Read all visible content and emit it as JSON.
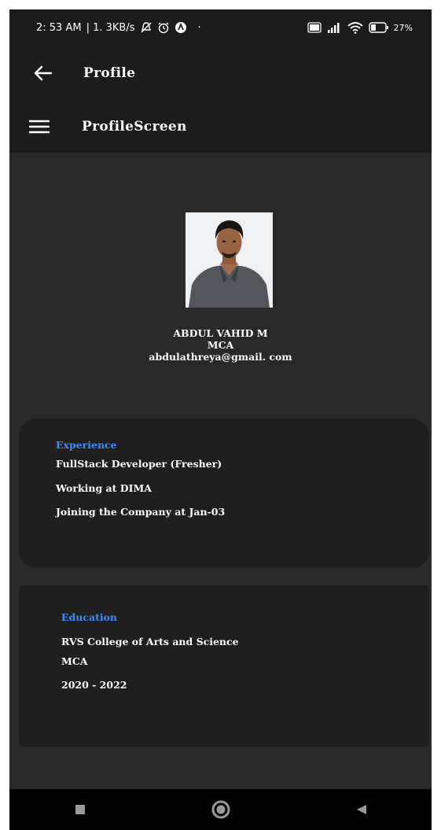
{
  "status_bar": {
    "time": "2: 53 AM",
    "speed": "| 1. 3KB/s",
    "battery": "27%",
    "icons": [
      "mute-icon",
      "alarm-icon",
      "app-icon",
      "volte-icon",
      "signal-icon",
      "wifi-icon",
      "battery-icon"
    ]
  },
  "header": {
    "title": "Profile",
    "subtitle": "ProfileScreen"
  },
  "profile": {
    "name": "ABDUL VAHID M",
    "degree": "MCA",
    "email": "abdulathreya@gmail. com"
  },
  "experience": {
    "title": "Experience",
    "lines": [
      "FullStack Developer (Fresher)",
      "Working at DIMA",
      "Joining the Company at Jan-03"
    ]
  },
  "education": {
    "title": "Education",
    "lines": [
      "RVS College of Arts and Science",
      "MCA",
      "2020 - 2022"
    ]
  },
  "colors": {
    "accent": "#3d8bff",
    "background": "#292929",
    "bar": "#1c1c1c",
    "card": "#1f1f1f"
  }
}
